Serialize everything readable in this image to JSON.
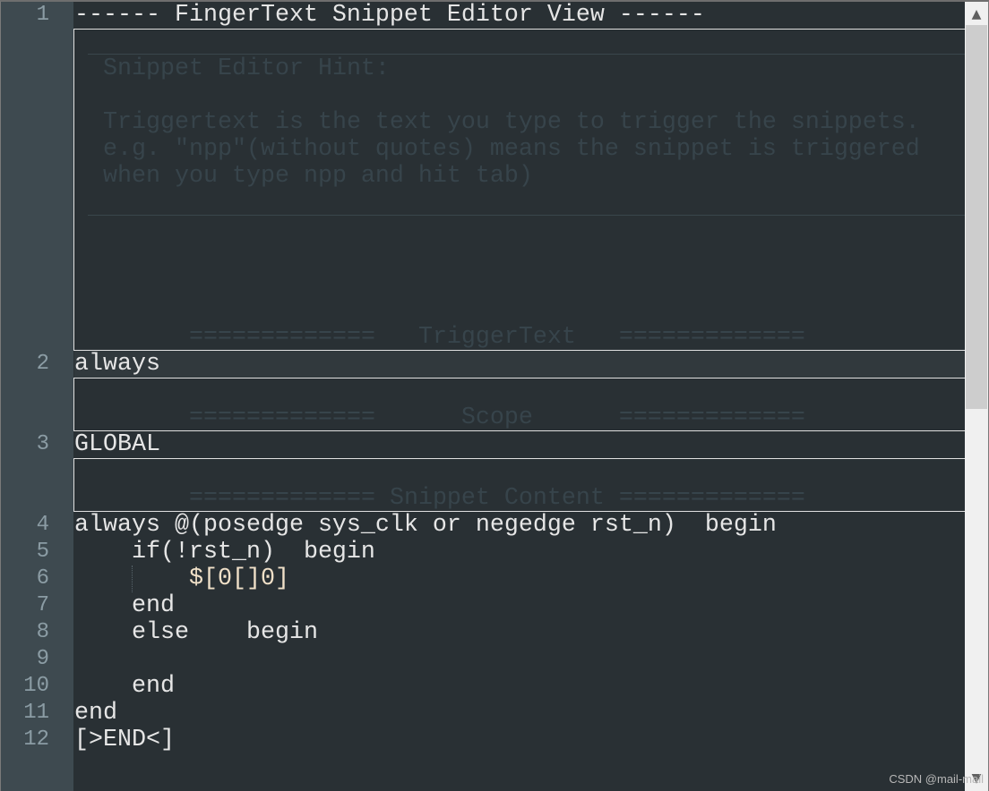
{
  "line_numbers": [
    "1",
    "2",
    "3",
    "4",
    "5",
    "6",
    "7",
    "8",
    "9",
    "10",
    "11",
    "12"
  ],
  "lines": {
    "l1": "------ FingerText Snippet Editor View ------",
    "l2": "always",
    "l3": "GLOBAL",
    "l4": "always @(posedge sys_clk or negedge rst_n)  begin",
    "l5": "    if(!rst_n)  begin",
    "l6": "        $[0[]0]",
    "l7": "    end",
    "l8": "    else    begin",
    "l9": "",
    "l10": "    end",
    "l11": "end",
    "l12": "[>END<]"
  },
  "annotations": {
    "hint_title": "Snippet Editor Hint:",
    "hint_lines": [
      "Triggertext is the text you type to trigger the snippets.",
      "e.g. \"npp\"(without quotes) means the snippet is triggered",
      "when you type npp and hit tab)"
    ],
    "trigger_sep": "=============   TriggerText   =============",
    "scope_sep": "=============      Scope      =============",
    "content_sep": "============= Snippet Content ============="
  },
  "scrollbar": {
    "up_icon": "chevron-up-icon",
    "down_icon": "chevron-down-icon",
    "position": 0
  },
  "watermark": "CSDN @mail-mail",
  "colors": {
    "background": "#293034",
    "gutter": "#3e4a50",
    "text": "#e6e6e6",
    "annotation": "#37444b"
  }
}
